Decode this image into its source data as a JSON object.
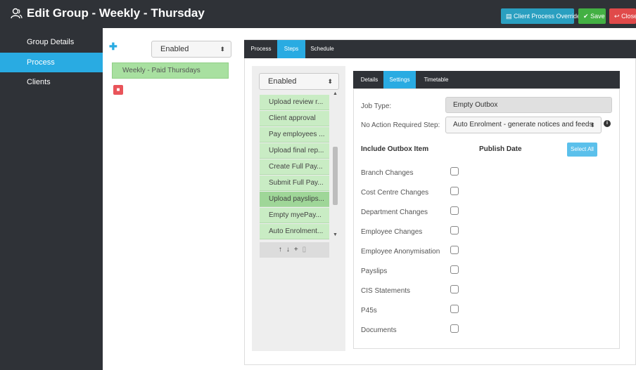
{
  "header": {
    "title": "Edit Group - Weekly - Thursday",
    "title_icon": "group-icon",
    "override_label": "Client Process Override",
    "save_label": "Save",
    "close_label": "Close",
    "colors": {
      "bar": "#2f3237",
      "override": "#2a9fc0",
      "save": "#43b043",
      "close": "#e04a4a"
    }
  },
  "sidebar": {
    "items": [
      {
        "label": "Group Details",
        "active": false
      },
      {
        "label": "Process",
        "active": true
      },
      {
        "label": "Clients",
        "active": false
      }
    ],
    "active_color": "#29abe2"
  },
  "process": {
    "add_icon": "plus-icon",
    "status_select": "Enabled",
    "groups": [
      "Weekly - Paid Thursdays"
    ],
    "delete_icon": "trash-icon"
  },
  "tabs": [
    "Process",
    "Steps",
    "Schedule"
  ],
  "active_tab": "Steps",
  "steps": {
    "status_select": "Enabled",
    "items": [
      "Upload review r...",
      "Client approval",
      "Pay employees ...",
      "Upload final rep...",
      "Create Full Pay...",
      "Submit Full Pay...",
      "Upload payslips...",
      "Empty myePay...",
      "Auto Enrolment..."
    ],
    "selected_index": 6,
    "toolbar_icons": [
      "arrow-up-icon",
      "arrow-down-icon",
      "plus-icon",
      "trash-icon"
    ]
  },
  "detail_tabs": [
    "Details",
    "Settings",
    "Timetable"
  ],
  "active_detail_tab": "Settings",
  "settings": {
    "job_type_label": "Job Type:",
    "job_type_value": "Empty Outbox",
    "no_action_label": "No Action Required Step:",
    "no_action_value": "Auto Enrolment - generate notices and feeds",
    "include_header": "Include Outbox Item",
    "publish_header": "Publish Date",
    "select_all_label": "Select All",
    "outbox_items": [
      {
        "label": "Branch Changes",
        "checked": false
      },
      {
        "label": "Cost Centre Changes",
        "checked": false
      },
      {
        "label": "Department Changes",
        "checked": false
      },
      {
        "label": "Employee Changes",
        "checked": false
      },
      {
        "label": "Employee Anonymisation",
        "checked": false
      },
      {
        "label": "Payslips",
        "checked": false
      },
      {
        "label": "CIS Statements",
        "checked": false
      },
      {
        "label": "P45s",
        "checked": false
      },
      {
        "label": "Documents",
        "checked": false
      }
    ]
  }
}
